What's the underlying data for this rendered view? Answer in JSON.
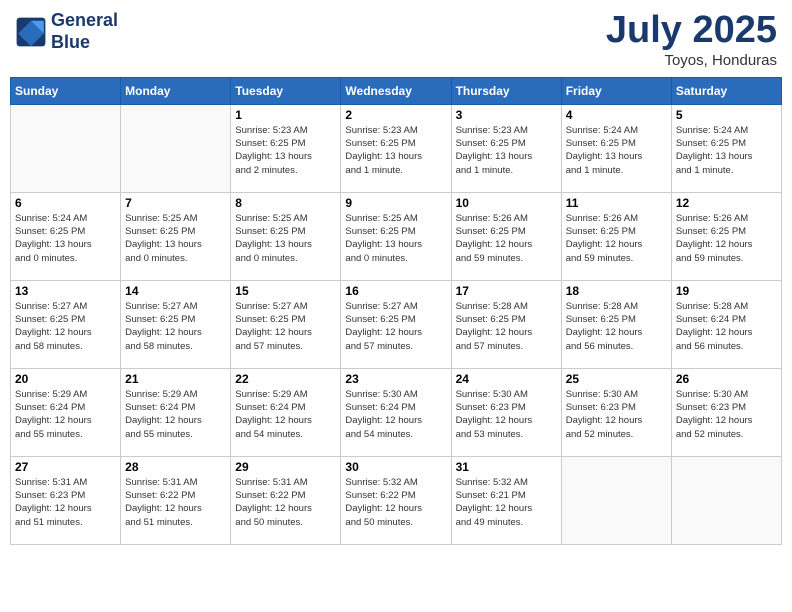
{
  "header": {
    "logo_line1": "General",
    "logo_line2": "Blue",
    "month": "July 2025",
    "location": "Toyos, Honduras"
  },
  "weekdays": [
    "Sunday",
    "Monday",
    "Tuesday",
    "Wednesday",
    "Thursday",
    "Friday",
    "Saturday"
  ],
  "weeks": [
    [
      {
        "day": "",
        "info": ""
      },
      {
        "day": "",
        "info": ""
      },
      {
        "day": "1",
        "info": "Sunrise: 5:23 AM\nSunset: 6:25 PM\nDaylight: 13 hours\nand 2 minutes."
      },
      {
        "day": "2",
        "info": "Sunrise: 5:23 AM\nSunset: 6:25 PM\nDaylight: 13 hours\nand 1 minute."
      },
      {
        "day": "3",
        "info": "Sunrise: 5:23 AM\nSunset: 6:25 PM\nDaylight: 13 hours\nand 1 minute."
      },
      {
        "day": "4",
        "info": "Sunrise: 5:24 AM\nSunset: 6:25 PM\nDaylight: 13 hours\nand 1 minute."
      },
      {
        "day": "5",
        "info": "Sunrise: 5:24 AM\nSunset: 6:25 PM\nDaylight: 13 hours\nand 1 minute."
      }
    ],
    [
      {
        "day": "6",
        "info": "Sunrise: 5:24 AM\nSunset: 6:25 PM\nDaylight: 13 hours\nand 0 minutes."
      },
      {
        "day": "7",
        "info": "Sunrise: 5:25 AM\nSunset: 6:25 PM\nDaylight: 13 hours\nand 0 minutes."
      },
      {
        "day": "8",
        "info": "Sunrise: 5:25 AM\nSunset: 6:25 PM\nDaylight: 13 hours\nand 0 minutes."
      },
      {
        "day": "9",
        "info": "Sunrise: 5:25 AM\nSunset: 6:25 PM\nDaylight: 13 hours\nand 0 minutes."
      },
      {
        "day": "10",
        "info": "Sunrise: 5:26 AM\nSunset: 6:25 PM\nDaylight: 12 hours\nand 59 minutes."
      },
      {
        "day": "11",
        "info": "Sunrise: 5:26 AM\nSunset: 6:25 PM\nDaylight: 12 hours\nand 59 minutes."
      },
      {
        "day": "12",
        "info": "Sunrise: 5:26 AM\nSunset: 6:25 PM\nDaylight: 12 hours\nand 59 minutes."
      }
    ],
    [
      {
        "day": "13",
        "info": "Sunrise: 5:27 AM\nSunset: 6:25 PM\nDaylight: 12 hours\nand 58 minutes."
      },
      {
        "day": "14",
        "info": "Sunrise: 5:27 AM\nSunset: 6:25 PM\nDaylight: 12 hours\nand 58 minutes."
      },
      {
        "day": "15",
        "info": "Sunrise: 5:27 AM\nSunset: 6:25 PM\nDaylight: 12 hours\nand 57 minutes."
      },
      {
        "day": "16",
        "info": "Sunrise: 5:27 AM\nSunset: 6:25 PM\nDaylight: 12 hours\nand 57 minutes."
      },
      {
        "day": "17",
        "info": "Sunrise: 5:28 AM\nSunset: 6:25 PM\nDaylight: 12 hours\nand 57 minutes."
      },
      {
        "day": "18",
        "info": "Sunrise: 5:28 AM\nSunset: 6:25 PM\nDaylight: 12 hours\nand 56 minutes."
      },
      {
        "day": "19",
        "info": "Sunrise: 5:28 AM\nSunset: 6:24 PM\nDaylight: 12 hours\nand 56 minutes."
      }
    ],
    [
      {
        "day": "20",
        "info": "Sunrise: 5:29 AM\nSunset: 6:24 PM\nDaylight: 12 hours\nand 55 minutes."
      },
      {
        "day": "21",
        "info": "Sunrise: 5:29 AM\nSunset: 6:24 PM\nDaylight: 12 hours\nand 55 minutes."
      },
      {
        "day": "22",
        "info": "Sunrise: 5:29 AM\nSunset: 6:24 PM\nDaylight: 12 hours\nand 54 minutes."
      },
      {
        "day": "23",
        "info": "Sunrise: 5:30 AM\nSunset: 6:24 PM\nDaylight: 12 hours\nand 54 minutes."
      },
      {
        "day": "24",
        "info": "Sunrise: 5:30 AM\nSunset: 6:23 PM\nDaylight: 12 hours\nand 53 minutes."
      },
      {
        "day": "25",
        "info": "Sunrise: 5:30 AM\nSunset: 6:23 PM\nDaylight: 12 hours\nand 52 minutes."
      },
      {
        "day": "26",
        "info": "Sunrise: 5:30 AM\nSunset: 6:23 PM\nDaylight: 12 hours\nand 52 minutes."
      }
    ],
    [
      {
        "day": "27",
        "info": "Sunrise: 5:31 AM\nSunset: 6:23 PM\nDaylight: 12 hours\nand 51 minutes."
      },
      {
        "day": "28",
        "info": "Sunrise: 5:31 AM\nSunset: 6:22 PM\nDaylight: 12 hours\nand 51 minutes."
      },
      {
        "day": "29",
        "info": "Sunrise: 5:31 AM\nSunset: 6:22 PM\nDaylight: 12 hours\nand 50 minutes."
      },
      {
        "day": "30",
        "info": "Sunrise: 5:32 AM\nSunset: 6:22 PM\nDaylight: 12 hours\nand 50 minutes."
      },
      {
        "day": "31",
        "info": "Sunrise: 5:32 AM\nSunset: 6:21 PM\nDaylight: 12 hours\nand 49 minutes."
      },
      {
        "day": "",
        "info": ""
      },
      {
        "day": "",
        "info": ""
      }
    ]
  ]
}
